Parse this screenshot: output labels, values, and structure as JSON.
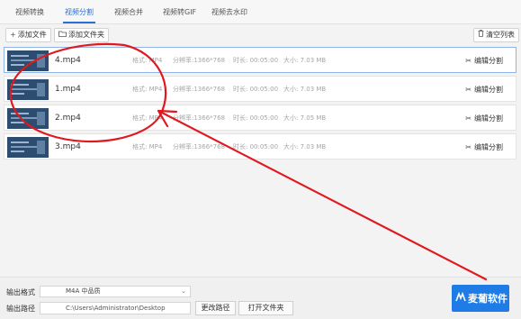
{
  "tabs": [
    "视频转换",
    "视频分割",
    "视频合并",
    "视频转GIF",
    "视频去水印"
  ],
  "toolbar": {
    "add_file": "添加文件",
    "add_folder": "添加文件夹",
    "clear_list": "清空列表"
  },
  "files": [
    {
      "name": "4.mp4",
      "format": "格式: MP4",
      "resolution": "分辨率:1366*768",
      "duration": "时长: 00:05:00",
      "size": "大小: 7.03 MB",
      "action": "编辑分割"
    },
    {
      "name": "1.mp4",
      "format": "格式: MP4",
      "resolution": "分辨率:1366*768",
      "duration": "时长: 00:05:00",
      "size": "大小: 7.03 MB",
      "action": "编辑分割"
    },
    {
      "name": "2.mp4",
      "format": "格式: MP4",
      "resolution": "分辨率:1366*768",
      "duration": "时长: 00:05:00",
      "size": "大小: 7.05 MB",
      "action": "编辑分割"
    },
    {
      "name": "3.mp4",
      "format": "格式: MP4",
      "resolution": "分辨率:1366*768",
      "duration": "时长: 00:05:00",
      "size": "大小: 7.03 MB",
      "action": "编辑分割"
    }
  ],
  "bottom": {
    "format_label": "输出格式",
    "format_value": "M4A  中品质",
    "path_label": "输出路径",
    "path_value": "C:\\Users\\Administrator\\Desktop",
    "change_path": "更改路径",
    "open_folder": "打开文件夹"
  },
  "brand": {
    "name": "麦葡软件"
  },
  "colors": {
    "accent": "#2a6fd6",
    "annotation": "#e0191f",
    "brand_button": "#1f7be6"
  }
}
